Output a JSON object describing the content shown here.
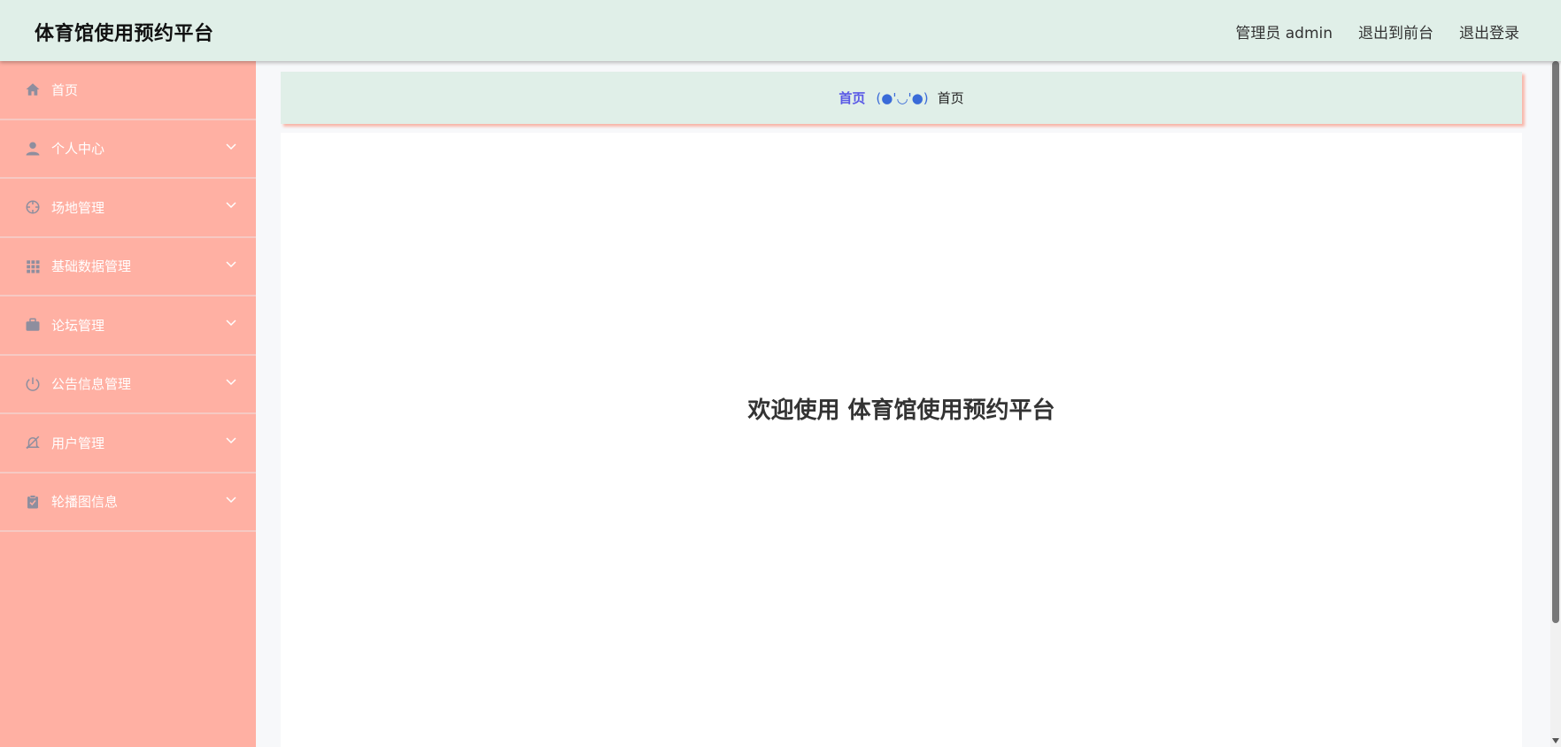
{
  "header": {
    "title": "体育馆使用预约平台",
    "user_label": "管理员 admin",
    "frontend_link": "退出到前台",
    "logout_link": "退出登录"
  },
  "sidebar": {
    "items": [
      {
        "label": "首页",
        "icon": "home-icon"
      },
      {
        "label": "个人中心",
        "icon": "user-icon"
      },
      {
        "label": "场地管理",
        "icon": "crosshair-icon"
      },
      {
        "label": "基础数据管理",
        "icon": "grid-icon"
      },
      {
        "label": "论坛管理",
        "icon": "briefcase-icon"
      },
      {
        "label": "公告信息管理",
        "icon": "power-icon"
      },
      {
        "label": "用户管理",
        "icon": "bell-off-icon"
      },
      {
        "label": "轮播图信息",
        "icon": "clipboard-check-icon"
      }
    ]
  },
  "breadcrumb": {
    "home": "首页",
    "separator": "(●'◡'●)",
    "current": "首页"
  },
  "main": {
    "welcome": "欢迎使用 体育馆使用预约平台"
  },
  "colors": {
    "header_bg": "#e0efe8",
    "sidebar_bg": "#ffb0a3",
    "sidebar_icon": "#8e8e9e",
    "breadcrumb_link": "#5a5ae6"
  }
}
